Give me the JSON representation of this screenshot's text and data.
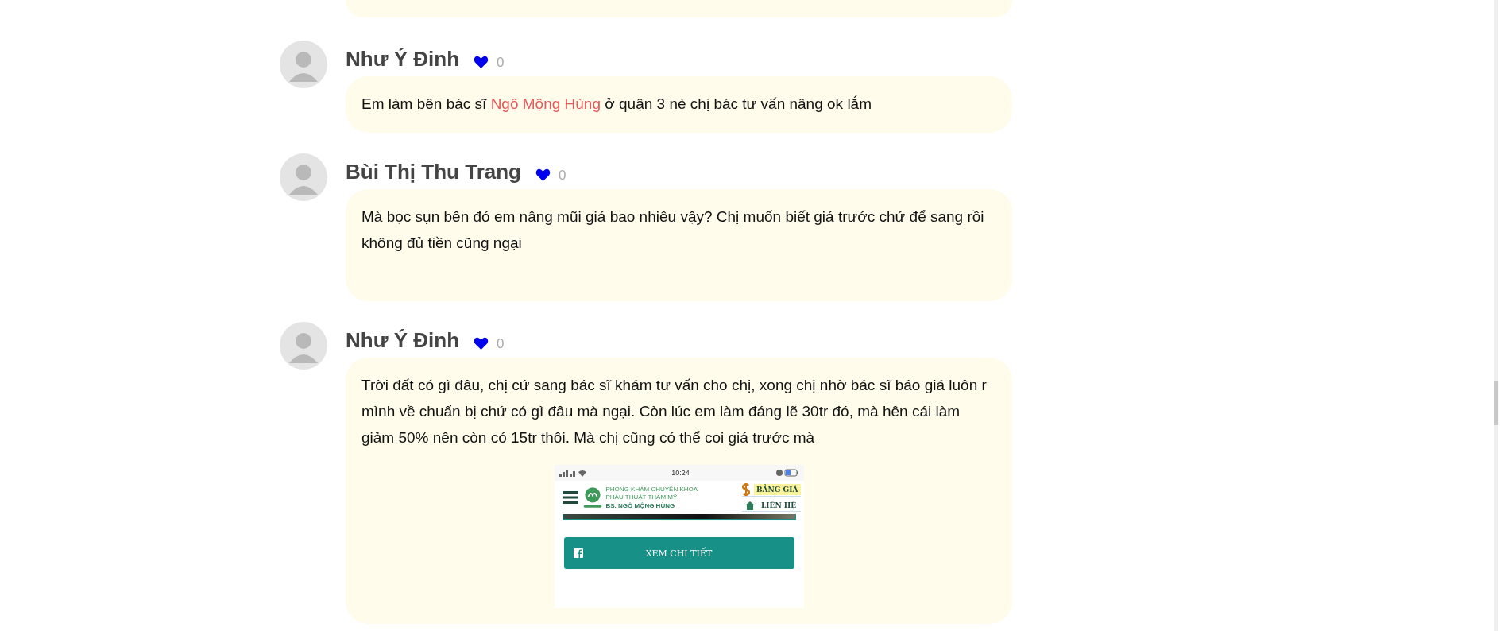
{
  "comments": [
    {
      "author": "Như Ý Đinh",
      "likes": "0",
      "body": [
        {
          "kind": "text",
          "text": "Em làm bên bác sĩ "
        },
        {
          "kind": "link",
          "text": "Ngô Mộng Hùng"
        },
        {
          "kind": "text",
          "text": " ở quận 3 nè chị bác tư vấn nâng ok lắm"
        }
      ]
    },
    {
      "author": "Bùi Thị Thu Trang",
      "likes": "0",
      "body": [
        {
          "kind": "text",
          "text": "Mà bọc sụn bên đó em nâng mũi giá bao nhiêu vậy? Chị muốn biết giá trước chứ để sang rồi không đủ tiền cũng ngại"
        }
      ]
    },
    {
      "author": "Như Ý Đinh",
      "likes": "0",
      "body": [
        {
          "kind": "text",
          "text": "Trời đất có gì đâu, chị cứ sang bác sĩ  khám tư vấn cho chị, xong chị nhờ bác sĩ báo giá luôn r mình về chuẩn bị chứ có gì đâu mà ngại. Còn lúc em làm đáng lẽ 30tr đó, mà hên cái làm giảm 50% nên còn có 15tr thôi. Mà chị cũng có thể coi giá trước mà"
        }
      ],
      "attachment": {
        "kind": "phone-screenshot",
        "status_time": "10:24",
        "clinic_lines": [
          "PHÒNG KHÁM CHUYÊN KHOA",
          "PHẪU THUẬT THẨM MỸ",
          "BS. NGÔ MỘNG HÙNG"
        ],
        "menu": [
          "BẢNG GIÁ",
          "LIÊN HỆ"
        ],
        "button": "XEM CHI TIẾT"
      }
    }
  ]
}
